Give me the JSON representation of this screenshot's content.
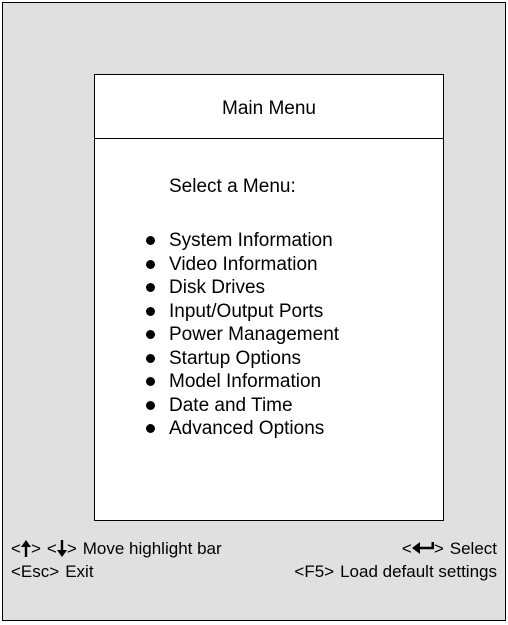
{
  "menu": {
    "title": "Main Menu",
    "prompt": "Select a Menu:",
    "items": [
      {
        "label": "System Information"
      },
      {
        "label": "Video Information"
      },
      {
        "label": "Disk Drives"
      },
      {
        "label": "Input/Output Ports"
      },
      {
        "label": "Power Management"
      },
      {
        "label": "Startup Options"
      },
      {
        "label": "Model Information"
      },
      {
        "label": "Date and Time"
      },
      {
        "label": "Advanced Options"
      }
    ]
  },
  "help": {
    "up_key_open": "<",
    "up_key_close": ">",
    "down_key_open": "<",
    "down_key_close": ">",
    "move_label": "Move highlight bar",
    "enter_key_open": "<",
    "enter_key_close": ">",
    "select_label": "Select",
    "esc_key": "<Esc>",
    "exit_label": "Exit",
    "f5_key": "<F5>",
    "load_defaults_label": "Load default settings",
    "icons": {
      "up": "up-arrow-icon",
      "down": "down-arrow-icon",
      "enter": "enter-arrow-icon"
    }
  }
}
